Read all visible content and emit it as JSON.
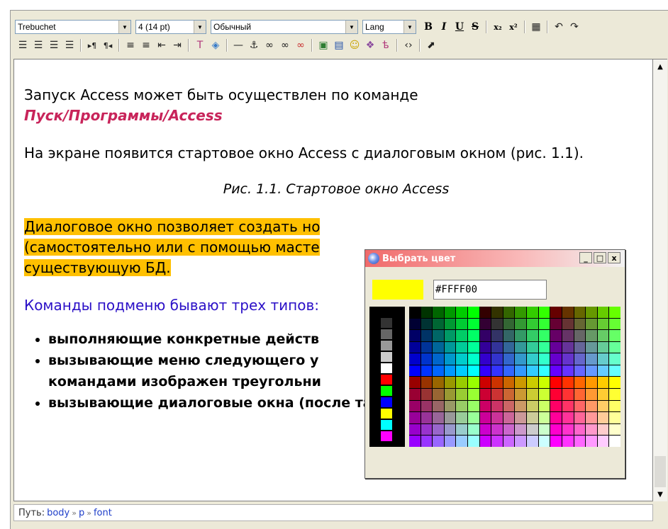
{
  "toolbar": {
    "font_family": "Trebuchet",
    "font_size": "4 (14 pt)",
    "format": "Обычный",
    "lang": "Lang",
    "row1_buttons": [
      "B",
      "I",
      "U",
      "S",
      "x₂",
      "x²"
    ],
    "icons_row1": [
      "paste-word-icon",
      "undo-icon",
      "redo-icon"
    ],
    "icons_row2": [
      "align-left-icon",
      "align-center-icon",
      "align-right-icon",
      "align-justify-icon",
      "ltr-icon",
      "rtl-icon",
      "ordered-list-icon",
      "unordered-list-icon",
      "outdent-icon",
      "indent-icon",
      "text-color-icon",
      "background-color-icon",
      "horizontal-rule-icon",
      "anchor-icon",
      "link-icon",
      "unlink-icon",
      "nolink-icon",
      "image-icon",
      "table-icon",
      "smiley-icon",
      "insert-object-icon",
      "char-map-icon",
      "html-source-icon",
      "fullscreen-icon"
    ]
  },
  "document": {
    "p1": "Запуск Access может быть осуществлен по команде",
    "p1_path": "Пуск/Программы/Access",
    "p2": "На экране появится стартовое окно Access с диалоговым окном (рис. 1.1).",
    "caption": "Рис. 1.1. Стартовое окно Access",
    "highlighted": [
      "Диалоговое окно позволяет создать но",
      "(самостоятельно или с помощью масте",
      "существующую БД."
    ],
    "blue_text": "Команды подменю бывают трех типов:",
    "bullets": [
      "выполняющие конкретные действ",
      "вызывающие меню следующего у",
      "командами изображен треугольни",
      "вызывающие диалоговые окна (после таких команд стоит"
    ]
  },
  "pathbar": {
    "label": "Путь:",
    "crumbs": [
      "body",
      "p",
      "font"
    ]
  },
  "dialog": {
    "title": "Выбрать цвет",
    "btn_min": "_",
    "btn_max": "□",
    "btn_close": "x",
    "current_color": "#FFFF00",
    "hex_value": "#FFFF00"
  },
  "colors": {
    "highlight": "#ffc000",
    "path_red": "#c8245a",
    "blue_text": "#2b10c7"
  }
}
